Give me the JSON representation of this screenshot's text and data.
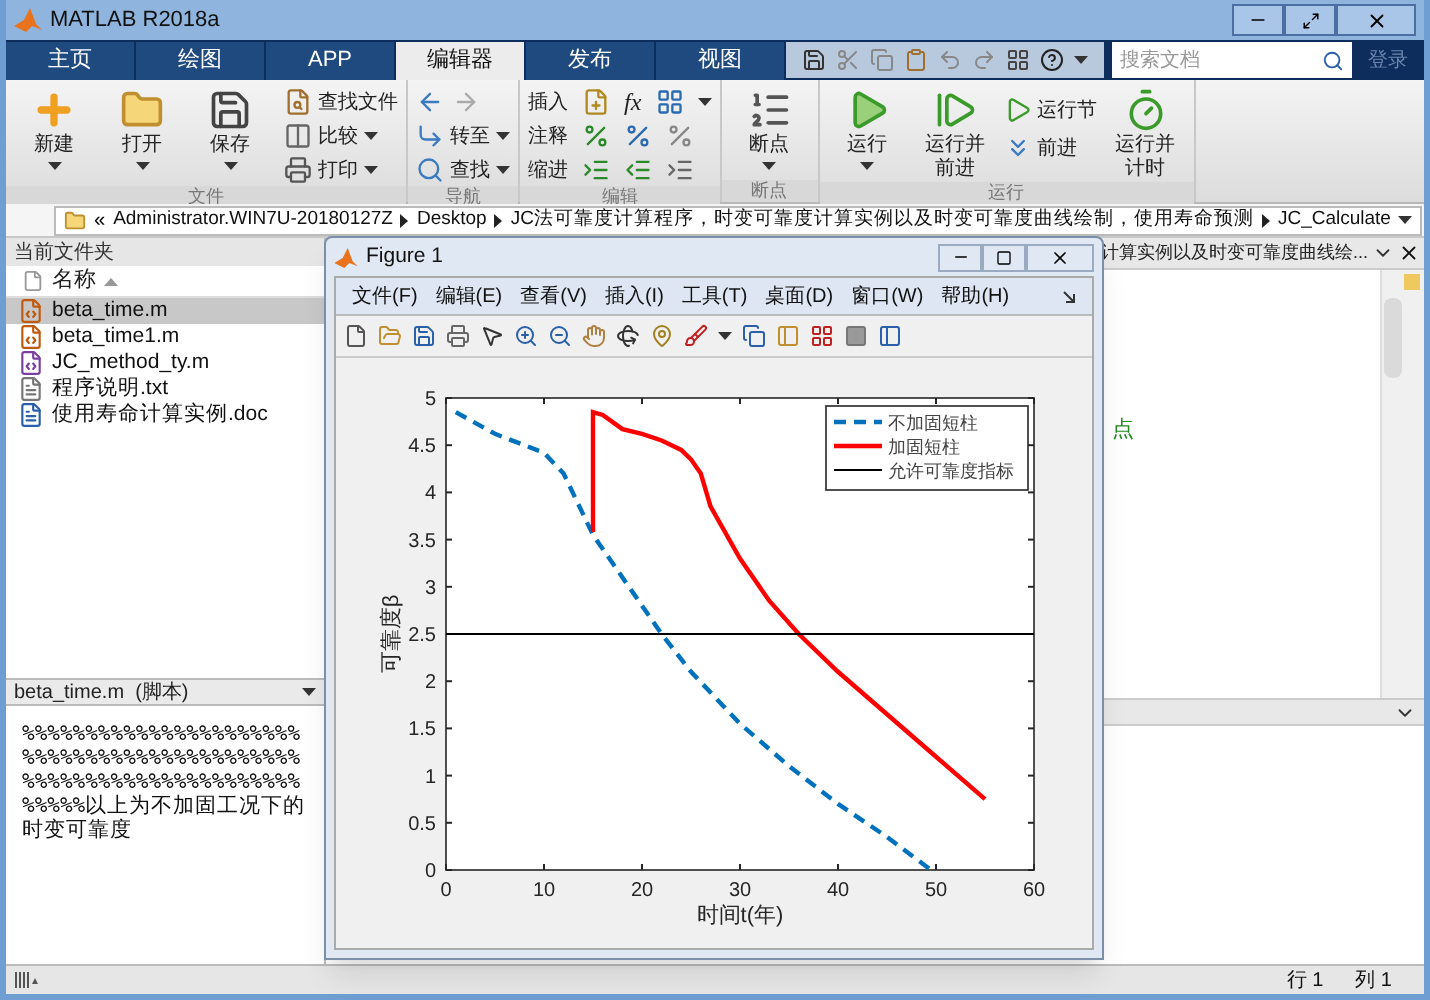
{
  "window": {
    "title": "MATLAB R2018a"
  },
  "tabs": [
    {
      "label": "主页",
      "selected": false
    },
    {
      "label": "绘图",
      "selected": false
    },
    {
      "label": "APP",
      "selected": false
    },
    {
      "label": "编辑器",
      "selected": true
    },
    {
      "label": "发布",
      "selected": false
    },
    {
      "label": "视图",
      "selected": false
    }
  ],
  "search": {
    "placeholder": "搜索文档"
  },
  "login_button": "登录",
  "ribbon": {
    "file": {
      "label": "文件",
      "large": [
        {
          "label": "新建"
        },
        {
          "label": "打开"
        },
        {
          "label": "保存"
        }
      ],
      "small": [
        {
          "label": "查找文件",
          "dropdown": false
        },
        {
          "label": "比较",
          "dropdown": true
        },
        {
          "label": "打印",
          "dropdown": true
        }
      ]
    },
    "navigate": {
      "label": "导航",
      "small": [
        {
          "label": "转至",
          "dropdown": true
        },
        {
          "label": "查找",
          "dropdown": true
        }
      ]
    },
    "edit": {
      "label": "编辑",
      "rows": [
        {
          "label": "插入",
          "symbol": "fx"
        },
        {
          "label": "注释"
        },
        {
          "label": "缩进"
        }
      ]
    },
    "breakpoints": {
      "label": "断点",
      "large": [
        {
          "label": "断点"
        }
      ]
    },
    "run": {
      "label": "运行",
      "large": [
        {
          "label": "运行"
        },
        {
          "label": "运行并前进"
        }
      ],
      "small": [
        {
          "label": "运行节"
        },
        {
          "label": "前进"
        }
      ],
      "timed": {
        "label": "运行并计时"
      }
    }
  },
  "address_bar": {
    "overflow_mark": "«",
    "segments": [
      "Administrator.WIN7U-20180127Z",
      "Desktop",
      "JC法可靠度计算程序，时变可靠度计算实例以及时变可靠度曲线绘制，使用寿命预测",
      "JC_Calculate"
    ]
  },
  "current_folder": {
    "title": "当前文件夹",
    "column": "名称",
    "files": [
      {
        "name": "beta_time.m",
        "kind": "script",
        "selected": true
      },
      {
        "name": "beta_time1.m",
        "kind": "script",
        "selected": false
      },
      {
        "name": "JC_method_ty.m",
        "kind": "function",
        "selected": false
      },
      {
        "name": "程序说明.txt",
        "kind": "text",
        "selected": false
      },
      {
        "name": "使用寿命计算实例.doc",
        "kind": "doc",
        "selected": false
      }
    ]
  },
  "details": {
    "title": "beta_time.m  (脚本)",
    "lines": [
      "%%%%%%%%%%%%%%%%%%%%%%",
      "%%%%%%%%%%%%%%%%%%%%%%",
      "%%%%%%%%%%%%%%%%%%%%%%",
      "%%%%%以上为不加固工况下的时变可靠度"
    ]
  },
  "editor": {
    "tab_title": "计算实例以及时变可靠度曲线绘...",
    "code_fragment": "点"
  },
  "figure": {
    "title": "Figure 1",
    "menu": [
      "文件(F)",
      "编辑(E)",
      "查看(V)",
      "插入(I)",
      "工具(T)",
      "桌面(D)",
      "窗口(W)",
      "帮助(H)"
    ],
    "chart_data": {
      "type": "line",
      "xlabel": "时间t(年)",
      "ylabel": "可靠度β",
      "xlim": [
        0,
        60
      ],
      "ylim": [
        0,
        5
      ],
      "xticks": [
        0,
        10,
        20,
        30,
        40,
        50,
        60
      ],
      "yticks": [
        0,
        0.5,
        1,
        1.5,
        2,
        2.5,
        3,
        3.5,
        4,
        4.5,
        5
      ],
      "legend": true,
      "series": [
        {
          "name": "不加固短柱",
          "color": "#0072bd",
          "line_style": "dashed",
          "x": [
            1,
            5,
            10,
            12,
            15,
            20,
            22,
            25,
            30,
            35,
            40,
            45,
            49.5
          ],
          "values": [
            4.85,
            4.62,
            4.42,
            4.2,
            3.55,
            2.8,
            2.5,
            2.1,
            1.55,
            1.1,
            0.7,
            0.35,
            0
          ]
        },
        {
          "name": "加固短柱",
          "color": "#ff0000",
          "line_style": "solid",
          "x": [
            15,
            15,
            16,
            18,
            20,
            22,
            24,
            25,
            26,
            27,
            30,
            33,
            36,
            40,
            45,
            50,
            55
          ],
          "values": [
            3.58,
            4.85,
            4.82,
            4.67,
            4.62,
            4.55,
            4.45,
            4.35,
            4.2,
            3.85,
            3.3,
            2.85,
            2.5,
            2.1,
            1.65,
            1.2,
            0.75
          ]
        },
        {
          "name": "允许可靠度指标",
          "color": "#000000",
          "line_style": "solid",
          "x": [
            0,
            60
          ],
          "values": [
            2.5,
            2.5
          ]
        }
      ]
    }
  },
  "status_bar": {
    "position": [
      "行 1",
      "列 1"
    ]
  }
}
